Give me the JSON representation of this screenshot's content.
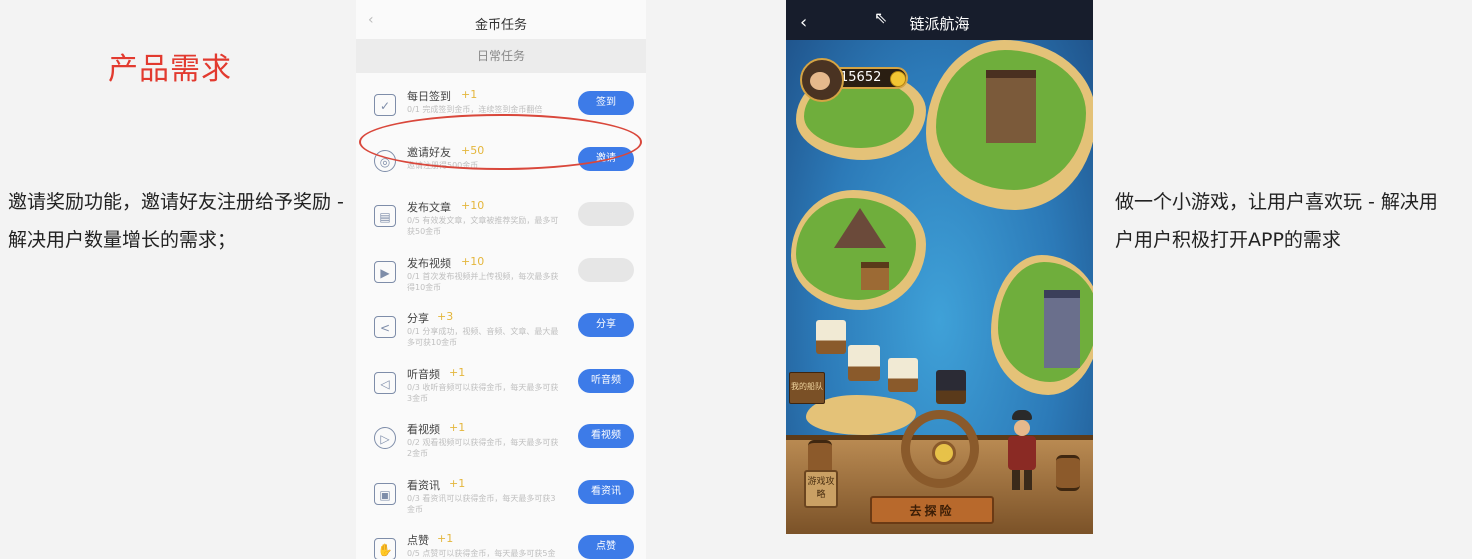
{
  "left": {
    "heading": "产品需求",
    "description": "邀请奖励功能，邀请好友注册给予奖励 - 解决用户数量增长的需求；"
  },
  "right": {
    "description": "做一个小游戏，让用户喜欢玩 - 解决用户用户积极打开APP的需求"
  },
  "task_screen": {
    "back": "‹",
    "title": "金币任务",
    "section": "日常任务",
    "tasks": [
      {
        "name": "每日签到",
        "reward": "+1",
        "desc": "0/1 完成签到金币，连续签到金币翻倍",
        "button": "签到",
        "icon": "checkin-icon",
        "glyph": "✓",
        "enabled": true
      },
      {
        "name": "邀请好友",
        "reward": "+50",
        "desc": "邀请注册得500金币",
        "button": "邀请",
        "icon": "invite-icon",
        "glyph": "◎",
        "enabled": true
      },
      {
        "name": "发布文章",
        "reward": "+10",
        "desc": "0/5 有效发文章，文章被推荐奖励，最多可获50金币",
        "button": "",
        "icon": "article-icon",
        "glyph": "▤",
        "enabled": false
      },
      {
        "name": "发布视频",
        "reward": "+10",
        "desc": "0/1 首次发布视频并上传视频，每次最多获得10金币",
        "button": "",
        "icon": "video-icon",
        "glyph": "▶",
        "enabled": false
      },
      {
        "name": "分享",
        "reward": "+3",
        "desc": "0/1 分享成功，视频、音频、文章、最大最多可获10金币",
        "button": "分享",
        "icon": "share-icon",
        "glyph": "<",
        "enabled": true
      },
      {
        "name": "听音频",
        "reward": "+1",
        "desc": "0/3 收听音频可以获得金币，每天最多可获3金币",
        "button": "听音频",
        "icon": "audio-icon",
        "glyph": "◁",
        "enabled": true
      },
      {
        "name": "看视频",
        "reward": "+1",
        "desc": "0/2 观看视频可以获得金币，每天最多可获2金币",
        "button": "看视频",
        "icon": "play-icon",
        "glyph": "▷",
        "enabled": true
      },
      {
        "name": "看资讯",
        "reward": "+1",
        "desc": "0/3 看资讯可以获得金币，每天最多可获3金币",
        "button": "看资讯",
        "icon": "news-icon",
        "glyph": "▣",
        "enabled": true
      },
      {
        "name": "点赞",
        "reward": "+1",
        "desc": "0/5 点赞可以获得金币，每天最多可获5金币",
        "button": "点赞",
        "icon": "like-icon",
        "glyph": "✋",
        "enabled": true
      }
    ]
  },
  "game_screen": {
    "back": "‹",
    "title": "链派航海",
    "coins": "15652",
    "sign": "我的船队",
    "guide": "游戏攻略",
    "adventure_button": "去探险"
  },
  "colors": {
    "accent_blue": "#3d7be8",
    "highlight_red": "#d9473b",
    "reward_gold": "#e4b63c"
  }
}
